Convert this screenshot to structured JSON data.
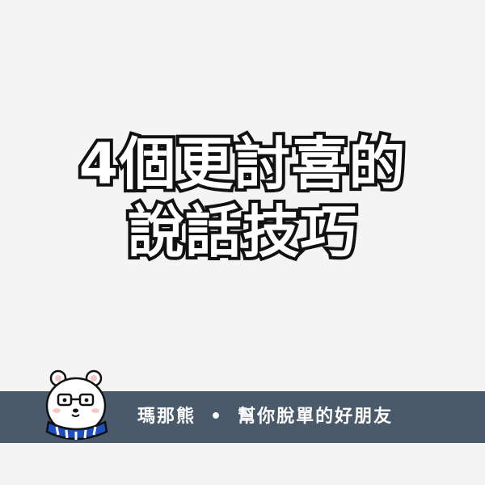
{
  "headline": {
    "line1": "4個更討喜的",
    "line2": "說話技巧"
  },
  "footer": {
    "brand": "瑪那熊",
    "separator": "•",
    "tagline": "幫你脫單的好朋友"
  },
  "mascot": {
    "icon": "polar-bear-with-glasses-and-scarf-icon"
  },
  "colors": {
    "background": "#f4f4f4",
    "footer_bar": "#4a5a6b",
    "headline_fill": "#ffffff",
    "headline_stroke": "#111111",
    "scarf": "#1f4fbf"
  }
}
